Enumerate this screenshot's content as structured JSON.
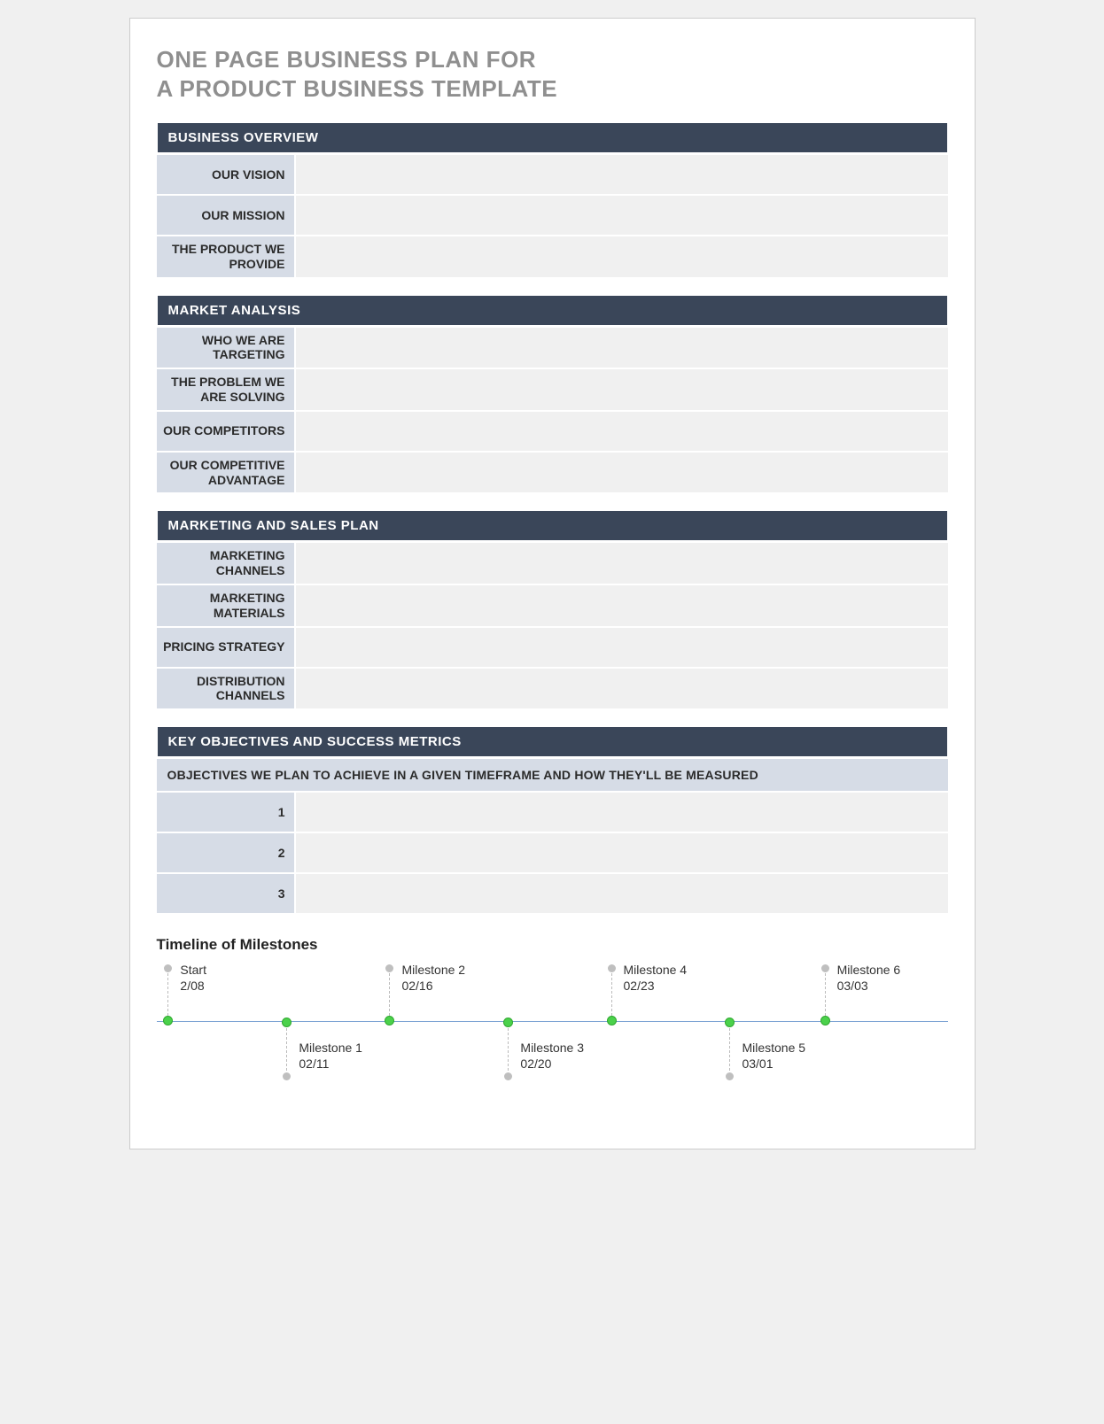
{
  "title_line1": "ONE PAGE BUSINESS PLAN FOR",
  "title_line2": "A PRODUCT BUSINESS TEMPLATE",
  "sections": {
    "business_overview": {
      "header": "BUSINESS OVERVIEW",
      "rows": {
        "vision": "OUR VISION",
        "mission": "OUR MISSION",
        "product": "THE PRODUCT WE PROVIDE"
      }
    },
    "market_analysis": {
      "header": "MARKET ANALYSIS",
      "rows": {
        "targeting": "WHO WE ARE TARGETING",
        "problem": "THE PROBLEM WE ARE SOLVING",
        "competitors": "OUR COMPETITORS",
        "advantage": "OUR COMPETITIVE ADVANTAGE"
      }
    },
    "marketing_sales": {
      "header": "MARKETING AND SALES PLAN",
      "rows": {
        "channels": "MARKETING CHANNELS",
        "materials": "MARKETING MATERIALS",
        "pricing": "PRICING STRATEGY",
        "distribution": "DISTRIBUTION CHANNELS"
      }
    },
    "objectives": {
      "header": "KEY OBJECTIVES AND SUCCESS METRICS",
      "subheader": "OBJECTIVES WE PLAN TO ACHIEVE IN A GIVEN TIMEFRAME AND HOW THEY'LL BE MEASURED",
      "rows": {
        "r1": "1",
        "r2": "2",
        "r3": "3"
      }
    }
  },
  "timeline": {
    "title": "Timeline of Milestones",
    "milestones": [
      {
        "label": "Start",
        "date": "2/08",
        "position": "above",
        "left_pct": 1
      },
      {
        "label": "Milestone 1",
        "date": "02/11",
        "position": "below",
        "left_pct": 16
      },
      {
        "label": "Milestone 2",
        "date": "02/16",
        "position": "above",
        "left_pct": 29
      },
      {
        "label": "Milestone 3",
        "date": "02/20",
        "position": "below",
        "left_pct": 44
      },
      {
        "label": "Milestone 4",
        "date": "02/23",
        "position": "above",
        "left_pct": 57
      },
      {
        "label": "Milestone 5",
        "date": "03/01",
        "position": "below",
        "left_pct": 72
      },
      {
        "label": "Milestone 6",
        "date": "03/03",
        "position": "above",
        "left_pct": 84
      }
    ]
  }
}
